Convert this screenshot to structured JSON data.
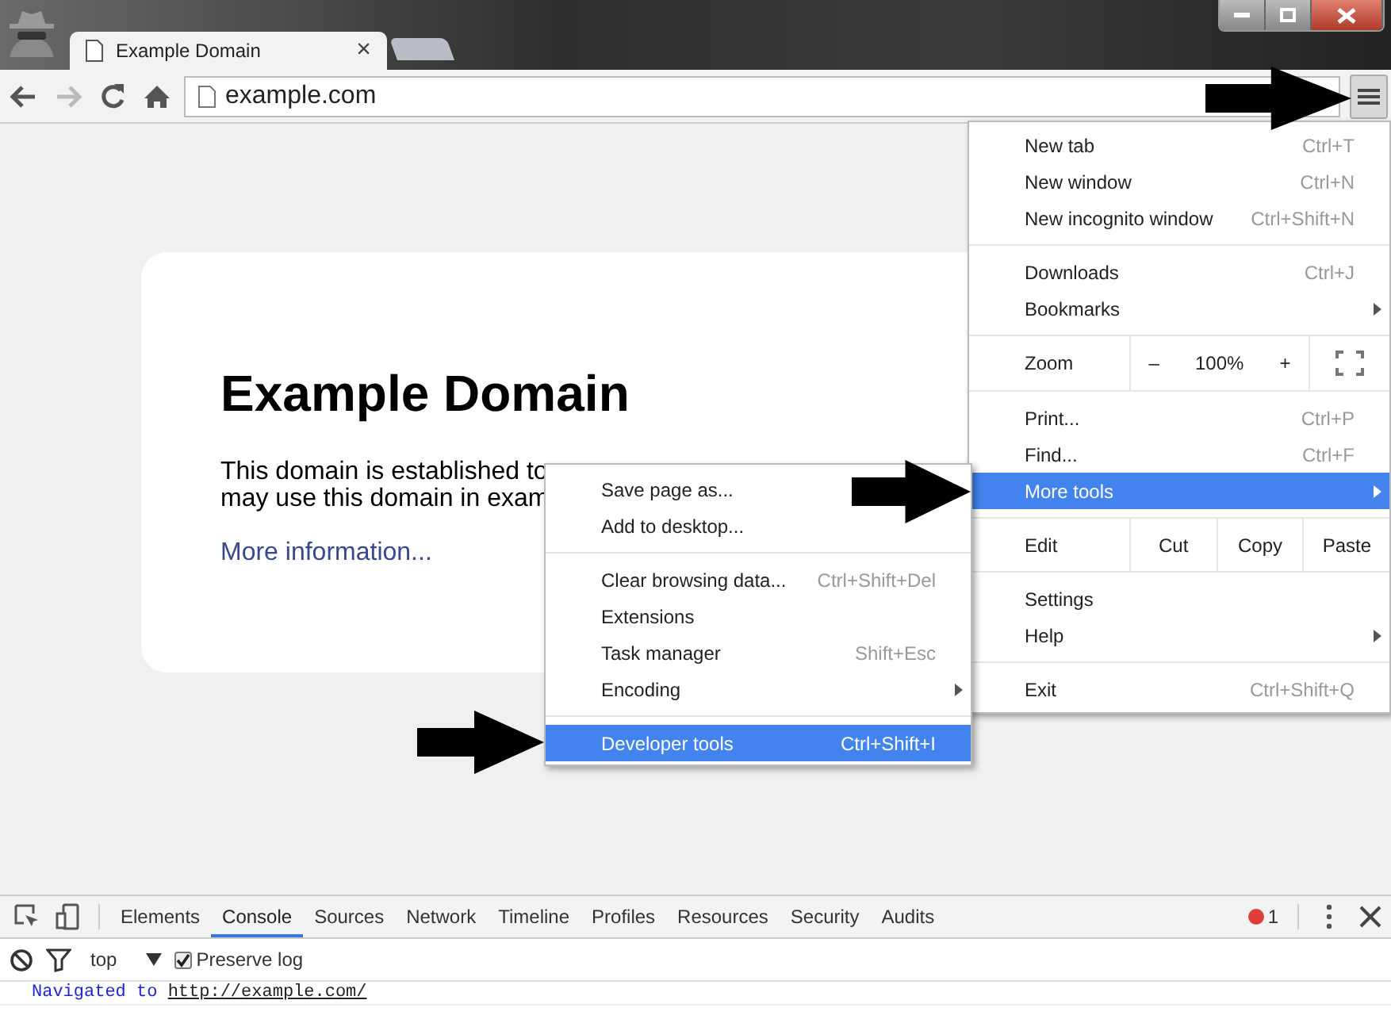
{
  "browser": {
    "tabs": [
      {
        "title": "Example Domain",
        "selected": true
      },
      {
        "selected": false
      }
    ],
    "close_symbol": "×"
  },
  "toolbar": {
    "address": "example.com",
    "forward_disabled": true
  },
  "page": {
    "heading": "Example Domain",
    "paragraph_lines": [
      "This domain is established to",
      "may use this domain in exam"
    ],
    "link": "More information..."
  },
  "menu": {
    "items": [
      {
        "kind": "item",
        "label": "New tab",
        "shortcut": "Ctrl+T",
        "selected": false
      },
      {
        "kind": "item",
        "label": "New window",
        "shortcut": "Ctrl+N",
        "selected": false
      },
      {
        "kind": "item",
        "label": "New incognito window",
        "shortcut": "Ctrl+Shift+N",
        "selected": false
      },
      {
        "kind": "separator"
      },
      {
        "kind": "item",
        "label": "Downloads",
        "shortcut": "Ctrl+J",
        "selected": false
      },
      {
        "kind": "item",
        "label": "Bookmarks",
        "submenu": true,
        "selected": false
      },
      {
        "kind": "zoom",
        "label": "Zoom",
        "minus": "–",
        "value": "100%",
        "plus": "+"
      },
      {
        "kind": "item",
        "label": "Print...",
        "shortcut": "Ctrl+P",
        "selected": false
      },
      {
        "kind": "item",
        "label": "Find...",
        "shortcut": "Ctrl+F",
        "selected": false
      },
      {
        "kind": "item",
        "label": "More tools",
        "submenu": true,
        "selected": true
      },
      {
        "kind": "edit",
        "label": "Edit",
        "buttons": [
          "Cut",
          "Copy",
          "Paste"
        ]
      },
      {
        "kind": "item",
        "label": "Settings",
        "selected": false
      },
      {
        "kind": "item",
        "label": "Help",
        "submenu": true,
        "selected": false
      },
      {
        "kind": "separator"
      },
      {
        "kind": "item",
        "label": "Exit",
        "shortcut": "Ctrl+Shift+Q",
        "selected": false
      }
    ]
  },
  "submenu": {
    "items": [
      {
        "kind": "item",
        "label": "Save page as...",
        "selected": false
      },
      {
        "kind": "item",
        "label": "Add to desktop...",
        "selected": false
      },
      {
        "kind": "separator"
      },
      {
        "kind": "item",
        "label": "Clear browsing data...",
        "shortcut": "Ctrl+Shift+Del",
        "selected": false
      },
      {
        "kind": "item",
        "label": "Extensions",
        "selected": false
      },
      {
        "kind": "item",
        "label": "Task manager",
        "shortcut": "Shift+Esc",
        "selected": false
      },
      {
        "kind": "item",
        "label": "Encoding",
        "submenu": true,
        "selected": false
      },
      {
        "kind": "separator"
      },
      {
        "kind": "item",
        "label": "Developer tools",
        "shortcut": "Ctrl+Shift+I",
        "selected": true
      }
    ]
  },
  "devtools": {
    "tabs": [
      {
        "label": "Elements",
        "selected": false
      },
      {
        "label": "Console",
        "selected": true
      },
      {
        "label": "Sources",
        "selected": false
      },
      {
        "label": "Network",
        "selected": false
      },
      {
        "label": "Timeline",
        "selected": false
      },
      {
        "label": "Profiles",
        "selected": false
      },
      {
        "label": "Resources",
        "selected": false
      },
      {
        "label": "Security",
        "selected": false
      },
      {
        "label": "Audits",
        "selected": false
      }
    ],
    "error_count": "1",
    "context": "top",
    "preserve_log": {
      "label": "Preserve log",
      "checked": true
    },
    "console_lines": [
      {
        "text": "Navigated to",
        "link": "http://example.com/"
      }
    ]
  }
}
